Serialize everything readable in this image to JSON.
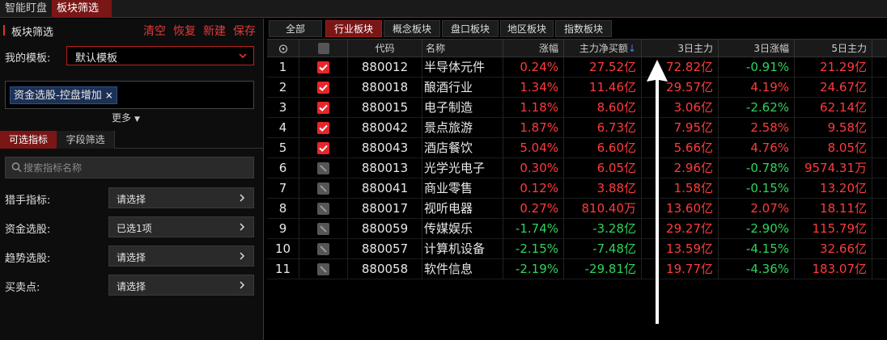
{
  "top_tabs": [
    "智能盯盘",
    "板块筛选"
  ],
  "left": {
    "title": "板块筛选",
    "actions": [
      "清空",
      "恢复",
      "新建",
      "保存"
    ],
    "template_label": "我的模板:",
    "template_value": "默认模板",
    "chip_label": "资金选股-控盘增加",
    "chip_close": "×",
    "more_label": "更多",
    "subtabs": [
      "可选指标",
      "字段筛选"
    ],
    "search_placeholder": "搜索指标名称",
    "filters": [
      {
        "label": "猎手指标:",
        "value": "请选择"
      },
      {
        "label": "资金选股:",
        "value": "已选1项"
      },
      {
        "label": "趋势选股:",
        "value": "请选择"
      },
      {
        "label": "买卖点:",
        "value": "请选择"
      }
    ]
  },
  "category_tabs": [
    "全部",
    "行业板块",
    "概念板块",
    "盘口板块",
    "地区板块",
    "指数板块"
  ],
  "active_category": 1,
  "table": {
    "headers": [
      "代码",
      "名称",
      "涨幅",
      "主力净买额",
      "3日主力",
      "3日涨幅",
      "5日主力"
    ],
    "sort_indicator": "↓",
    "rows": [
      {
        "no": "1",
        "checked": true,
        "code": "880012",
        "name": "半导体元件",
        "chg": "0.24%",
        "net": "27.52亿",
        "d3": "72.82亿",
        "d3chg": "-0.91%",
        "d5": "21.29亿"
      },
      {
        "no": "2",
        "checked": true,
        "code": "880018",
        "name": "酿酒行业",
        "chg": "1.34%",
        "net": "11.46亿",
        "d3": "29.57亿",
        "d3chg": "4.19%",
        "d5": "24.67亿"
      },
      {
        "no": "3",
        "checked": true,
        "code": "880015",
        "name": "电子制造",
        "chg": "1.18%",
        "net": "8.60亿",
        "d3": "3.06亿",
        "d3chg": "-2.62%",
        "d5": "62.14亿"
      },
      {
        "no": "4",
        "checked": true,
        "code": "880042",
        "name": "景点旅游",
        "chg": "1.87%",
        "net": "6.73亿",
        "d3": "7.95亿",
        "d3chg": "2.58%",
        "d5": "9.58亿"
      },
      {
        "no": "5",
        "checked": true,
        "code": "880043",
        "name": "酒店餐饮",
        "chg": "5.04%",
        "net": "6.60亿",
        "d3": "5.66亿",
        "d3chg": "4.76%",
        "d5": "8.05亿"
      },
      {
        "no": "6",
        "checked": false,
        "code": "880013",
        "name": "光学光电子",
        "chg": "0.30%",
        "net": "6.05亿",
        "d3": "2.96亿",
        "d3chg": "-0.78%",
        "d5": "9574.31万"
      },
      {
        "no": "7",
        "checked": false,
        "code": "880041",
        "name": "商业零售",
        "chg": "0.12%",
        "net": "3.88亿",
        "d3": "1.58亿",
        "d3chg": "-0.15%",
        "d5": "13.20亿"
      },
      {
        "no": "8",
        "checked": false,
        "code": "880017",
        "name": "视听电器",
        "chg": "0.27%",
        "net": "810.40万",
        "d3": "13.60亿",
        "d3chg": "2.07%",
        "d5": "18.11亿"
      },
      {
        "no": "9",
        "checked": false,
        "code": "880059",
        "name": "传媒娱乐",
        "chg": "-1.74%",
        "net": "-3.28亿",
        "d3": "29.27亿",
        "d3chg": "-2.90%",
        "d5": "115.79亿"
      },
      {
        "no": "10",
        "checked": false,
        "code": "880057",
        "name": "计算机设备",
        "chg": "-2.15%",
        "net": "-7.48亿",
        "d3": "13.59亿",
        "d3chg": "-4.15%",
        "d5": "32.66亿"
      },
      {
        "no": "11",
        "checked": false,
        "code": "880058",
        "name": "软件信息",
        "chg": "-2.19%",
        "net": "-29.81亿",
        "d3": "19.77亿",
        "d3chg": "-4.36%",
        "d5": "183.07亿"
      }
    ]
  },
  "colors": {
    "up": "#ff3b3b",
    "down": "#2fd35a",
    "accent": "#7a1616"
  }
}
